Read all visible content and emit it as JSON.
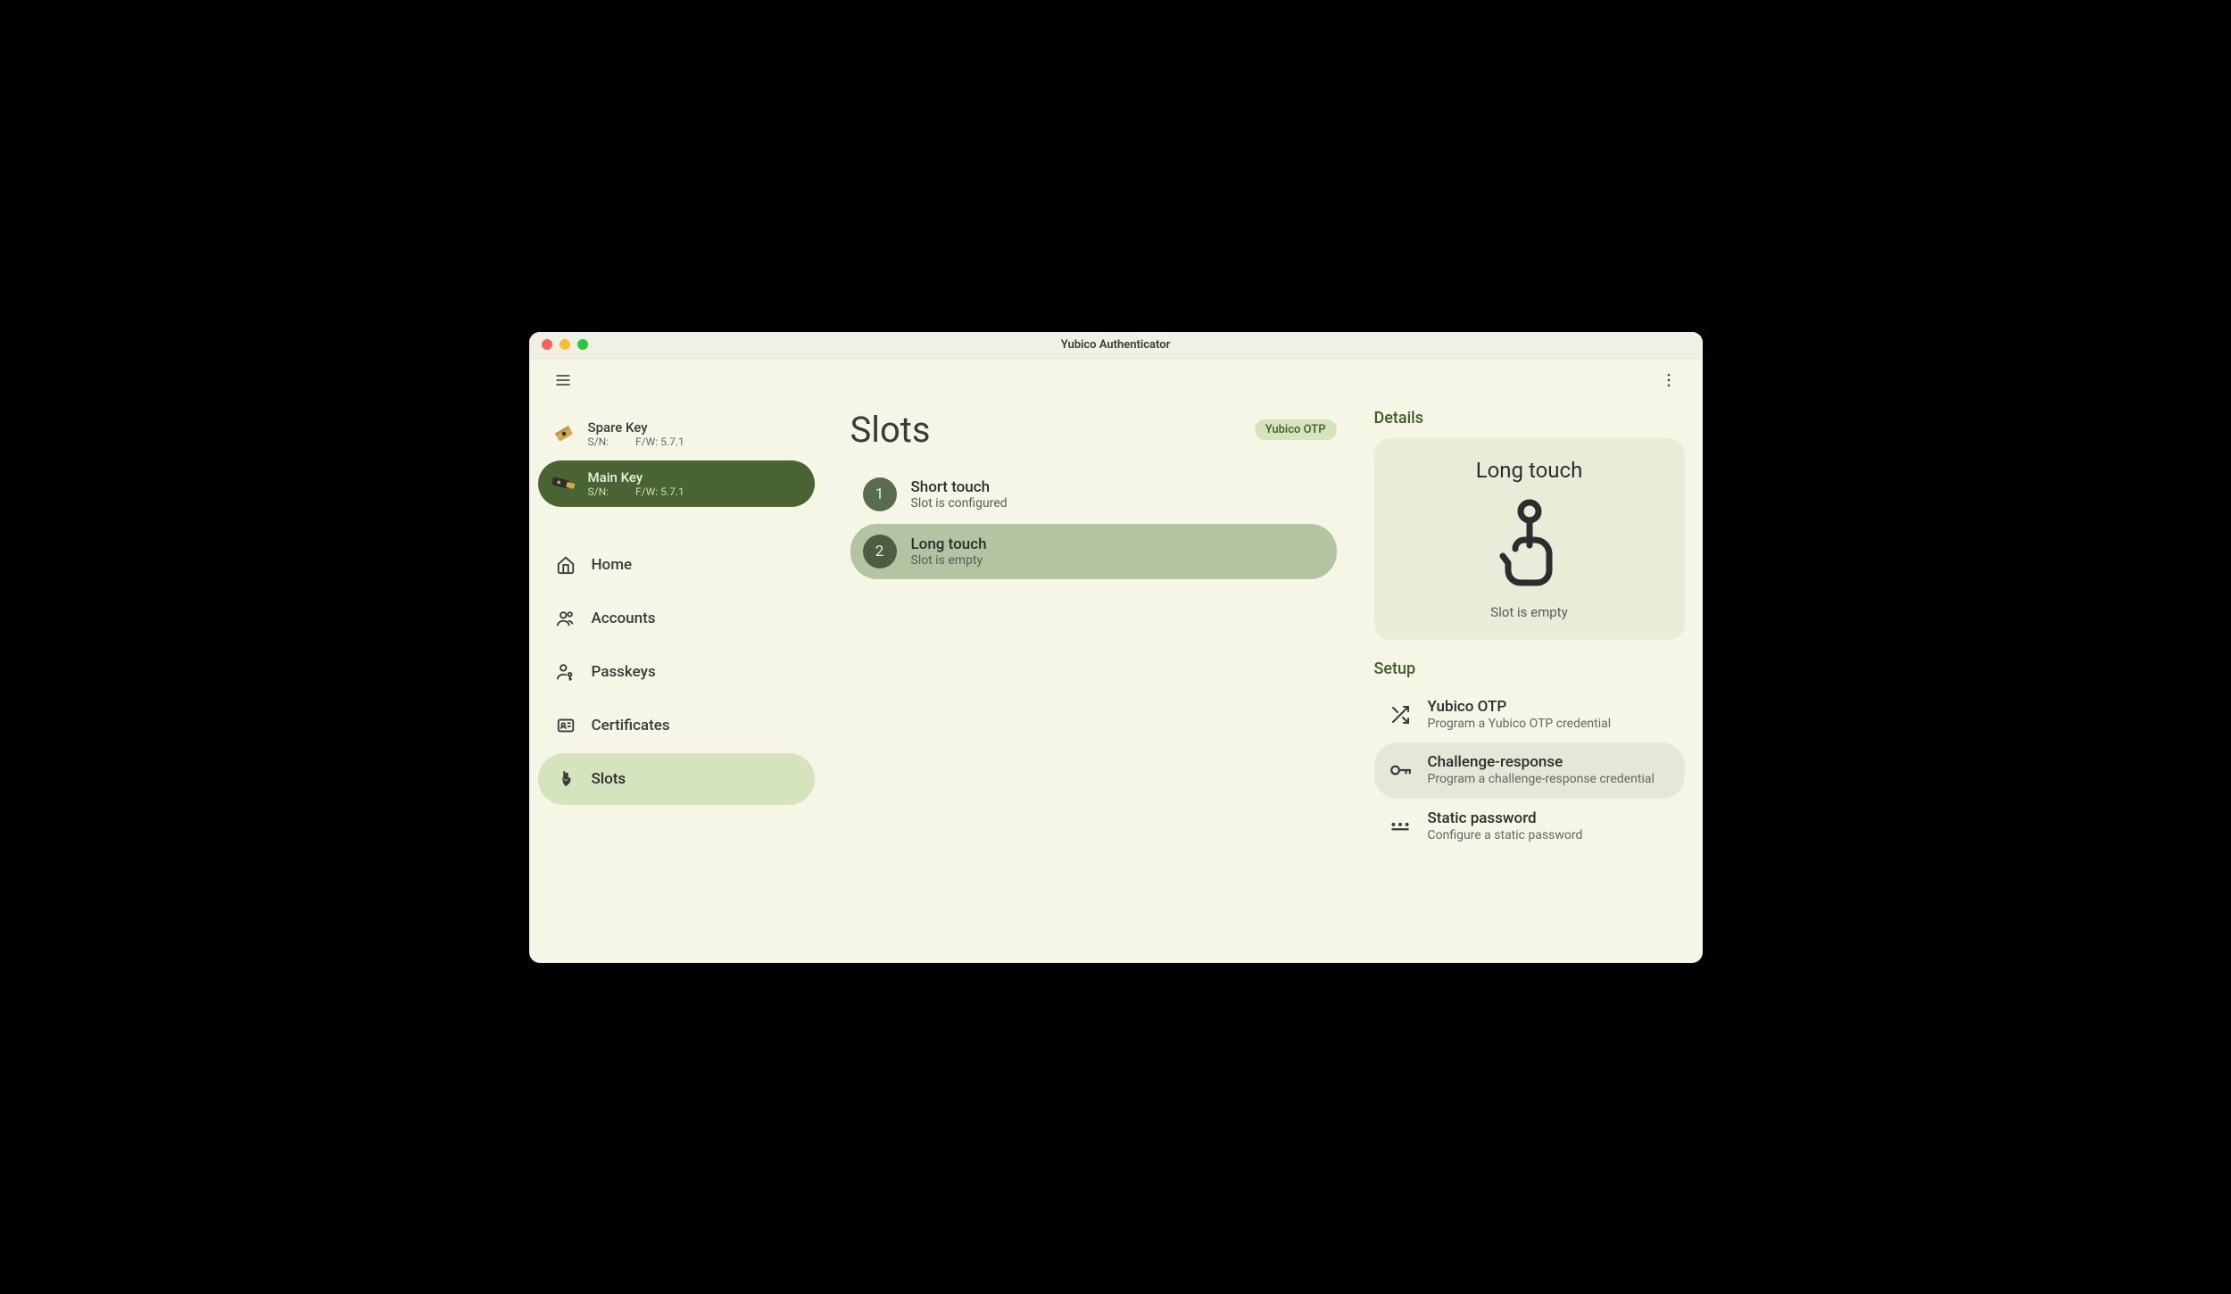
{
  "window": {
    "title": "Yubico Authenticator"
  },
  "devices": [
    {
      "name": "Spare Key",
      "sn_label": "S/N:",
      "fw_label": "F/W: 5.7.1",
      "selected": false
    },
    {
      "name": "Main Key",
      "sn_label": "S/N:",
      "fw_label": "F/W: 5.7.1",
      "selected": true
    }
  ],
  "nav": {
    "home": "Home",
    "accounts": "Accounts",
    "passkeys": "Passkeys",
    "certificates": "Certificates",
    "slots": "Slots"
  },
  "main": {
    "title": "Slots",
    "badge": "Yubico OTP",
    "slots": [
      {
        "num": "1",
        "name": "Short touch",
        "sub": "Slot is configured",
        "selected": false
      },
      {
        "num": "2",
        "name": "Long touch",
        "sub": "Slot is empty",
        "selected": true
      }
    ]
  },
  "details": {
    "heading": "Details",
    "title": "Long touch",
    "sub": "Slot is empty"
  },
  "setup": {
    "heading": "Setup",
    "items": [
      {
        "name": "Yubico OTP",
        "sub": "Program a Yubico OTP credential",
        "hover": false
      },
      {
        "name": "Challenge-response",
        "sub": "Program a challenge-response credential",
        "hover": true
      },
      {
        "name": "Static password",
        "sub": "Configure a static password",
        "hover": false
      }
    ]
  }
}
